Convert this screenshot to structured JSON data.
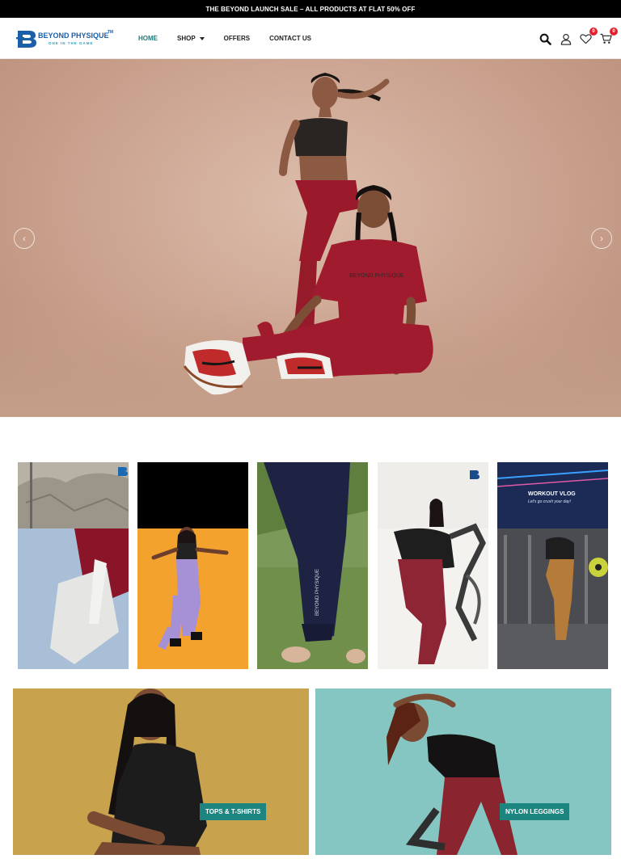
{
  "announcement": "THE BEYOND LAUNCH SALE – ALL PRODUCTS AT FLAT 50% OFF",
  "brand": {
    "name": "BEYOND PHYSIQUE",
    "trademark": "TM",
    "tagline": "ONE IN THE GAME"
  },
  "nav": {
    "home": "HOME",
    "shop": "SHOP",
    "offers": "OFFERS",
    "contact": "CONTACT US"
  },
  "header_icons": {
    "search": "search-icon",
    "account": "user-icon",
    "wishlist": "heart-icon",
    "cart": "cart-icon",
    "wishlist_count": "0",
    "cart_count": "0"
  },
  "hero": {
    "shirt_print": "BEYOND PHYSIQUE",
    "prev": "‹",
    "next": "›"
  },
  "gallery": {
    "tiles": [
      {
        "id": "rock-climb"
      },
      {
        "id": "orange-dance"
      },
      {
        "id": "leggings-closeup",
        "legging_print": "BEYOND PHYSIQUE"
      },
      {
        "id": "elliptical"
      },
      {
        "id": "workout-vlog",
        "title": "WORKOUT VLOG",
        "subtitle": "Let's go crush your day!"
      }
    ]
  },
  "categories": [
    {
      "label": "TOPS & T-SHIRTS",
      "bg": "#c8a24d"
    },
    {
      "label": "NYLON LEGGINGS",
      "bg": "#86c6c2"
    }
  ],
  "colors": {
    "accent": "#1c8580",
    "badge": "#e5202e",
    "nav_active": "#1f7a7a",
    "brand_blue": "#1a5fa8"
  }
}
